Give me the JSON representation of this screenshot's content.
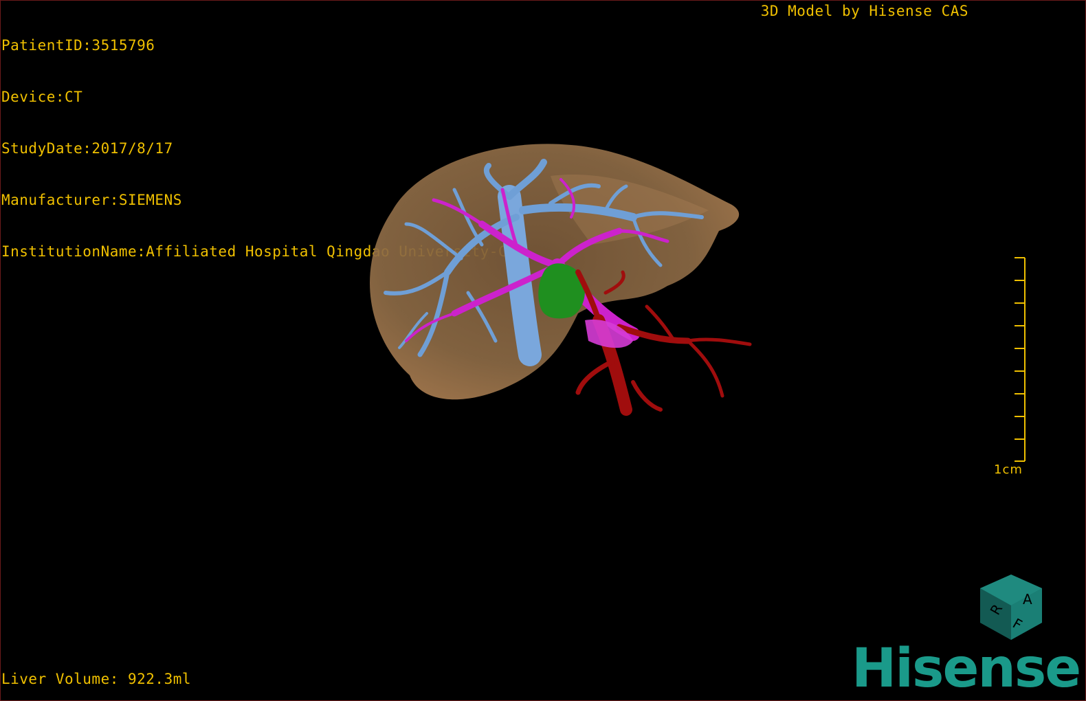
{
  "patient_info": {
    "patient_id": "PatientID:3515796",
    "device": "Device:CT",
    "study_date": "StudyDate:2017/8/17",
    "manufacturer": "Manufacturer:SIEMENS",
    "institution": "InstitutionName:Affiliated Hospital Qingdao University-C"
  },
  "title": "3D Model by Hisense CAS",
  "liver_volume": "Liver Volume: 922.3ml",
  "scale_label": "1cm",
  "orientation_cube": {
    "labels": [
      "A",
      "R",
      "F"
    ],
    "color": "#1a7f75"
  },
  "logo": "Hisense",
  "colors": {
    "overlay_text": "#f0c000",
    "liver": "#a57a4f",
    "hepatic_vein": "#6f9fd6",
    "portal_vein": "#cc22cc",
    "artery": "#a00d0d",
    "tumor": "#1f8f1f",
    "logo": "#1a9a8a"
  }
}
